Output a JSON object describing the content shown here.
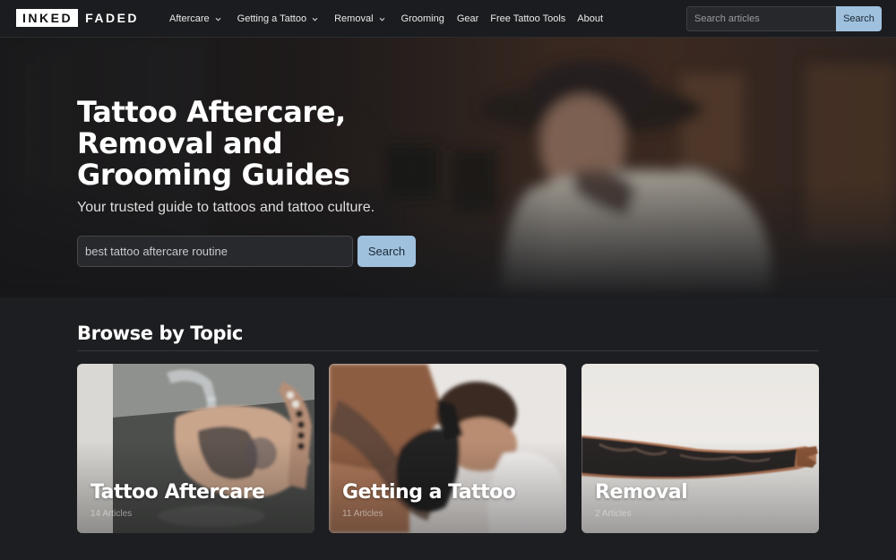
{
  "brand": {
    "word1": "INKED",
    "word2": "FADED"
  },
  "nav": {
    "items": [
      {
        "label": "Aftercare",
        "dropdown": true
      },
      {
        "label": "Getting a Tattoo",
        "dropdown": true
      },
      {
        "label": "Removal",
        "dropdown": true
      },
      {
        "label": "Grooming",
        "dropdown": false
      },
      {
        "label": "Gear",
        "dropdown": false
      },
      {
        "label": "Free Tattoo Tools",
        "dropdown": false
      },
      {
        "label": "About",
        "dropdown": false
      }
    ],
    "search_placeholder": "Search articles",
    "search_button": "Search"
  },
  "hero": {
    "title": "Tattoo Aftercare, Removal and Grooming Guides",
    "subtitle": "Your trusted guide to tattoos and tattoo culture.",
    "search_value": "best tattoo aftercare routine",
    "search_button": "Search"
  },
  "browse": {
    "title": "Browse by Topic",
    "cards": [
      {
        "title": "Tattoo Aftercare",
        "count": "14 Articles"
      },
      {
        "title": "Getting a Tattoo",
        "count": "11 Articles"
      },
      {
        "title": "Removal",
        "count": "2 Articles"
      }
    ]
  },
  "colors": {
    "background": "#1d1e21",
    "accent_button": "#9fc1de",
    "nav_background": "#1b1c1f"
  }
}
